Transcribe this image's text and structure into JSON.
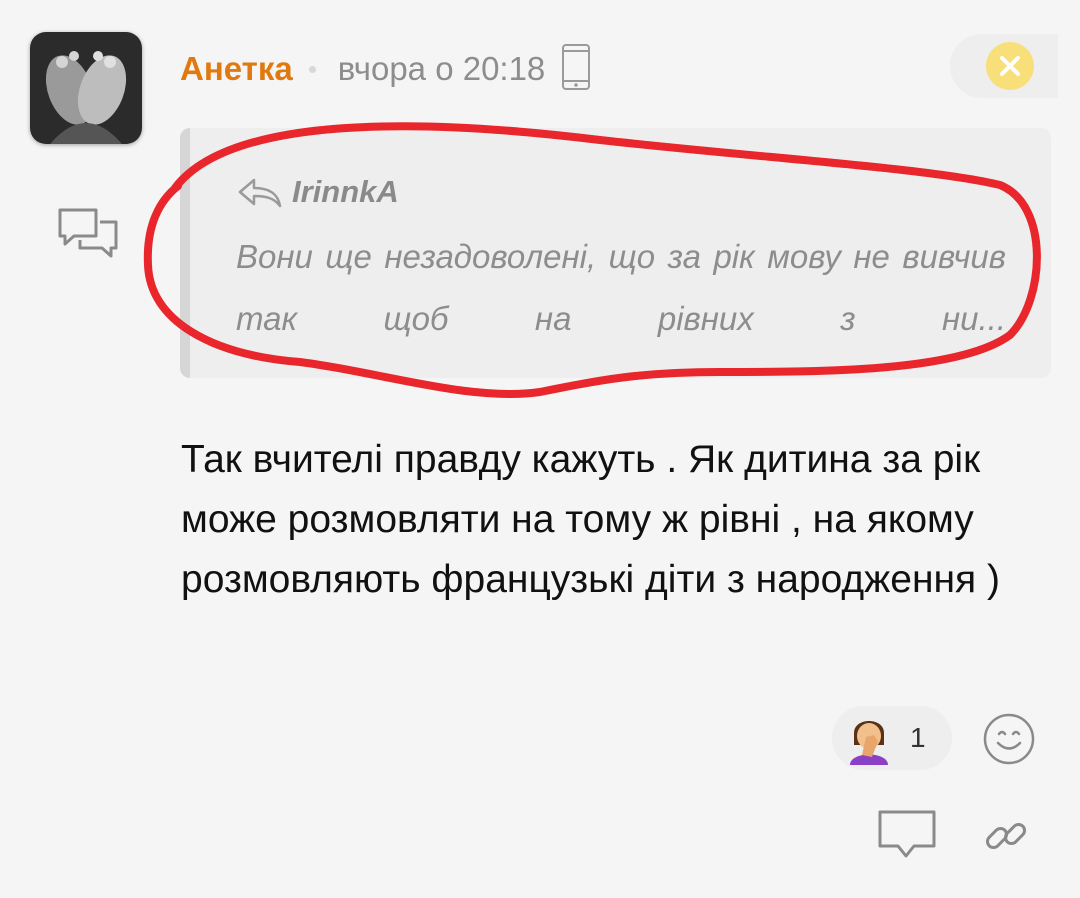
{
  "post": {
    "author": "Анетка",
    "time": "вчора о 20:18",
    "device_icon": "smartphone-icon"
  },
  "quote": {
    "author": "IrinnkA",
    "text": "Вони ще незадоволені, що за рік мову не вивчив так щоб на рівних з ни..."
  },
  "message": {
    "text": "Так вчителі правду кажуть . Як дитина за рік може розмовляти на тому ж рівні , на якому розмовляють французькі діти з народження )"
  },
  "reactions": [
    {
      "emoji": "facepalm-woman",
      "count": "1"
    }
  ],
  "colors": {
    "author": "#e07a10",
    "close_button": "#f8df7a",
    "annotation": "#e8262b",
    "background": "#f5f5f5"
  },
  "icons": [
    "close-icon",
    "reply-arrow-icon",
    "comments-icon",
    "smiley-icon",
    "comment-bubble-icon",
    "link-icon"
  ]
}
